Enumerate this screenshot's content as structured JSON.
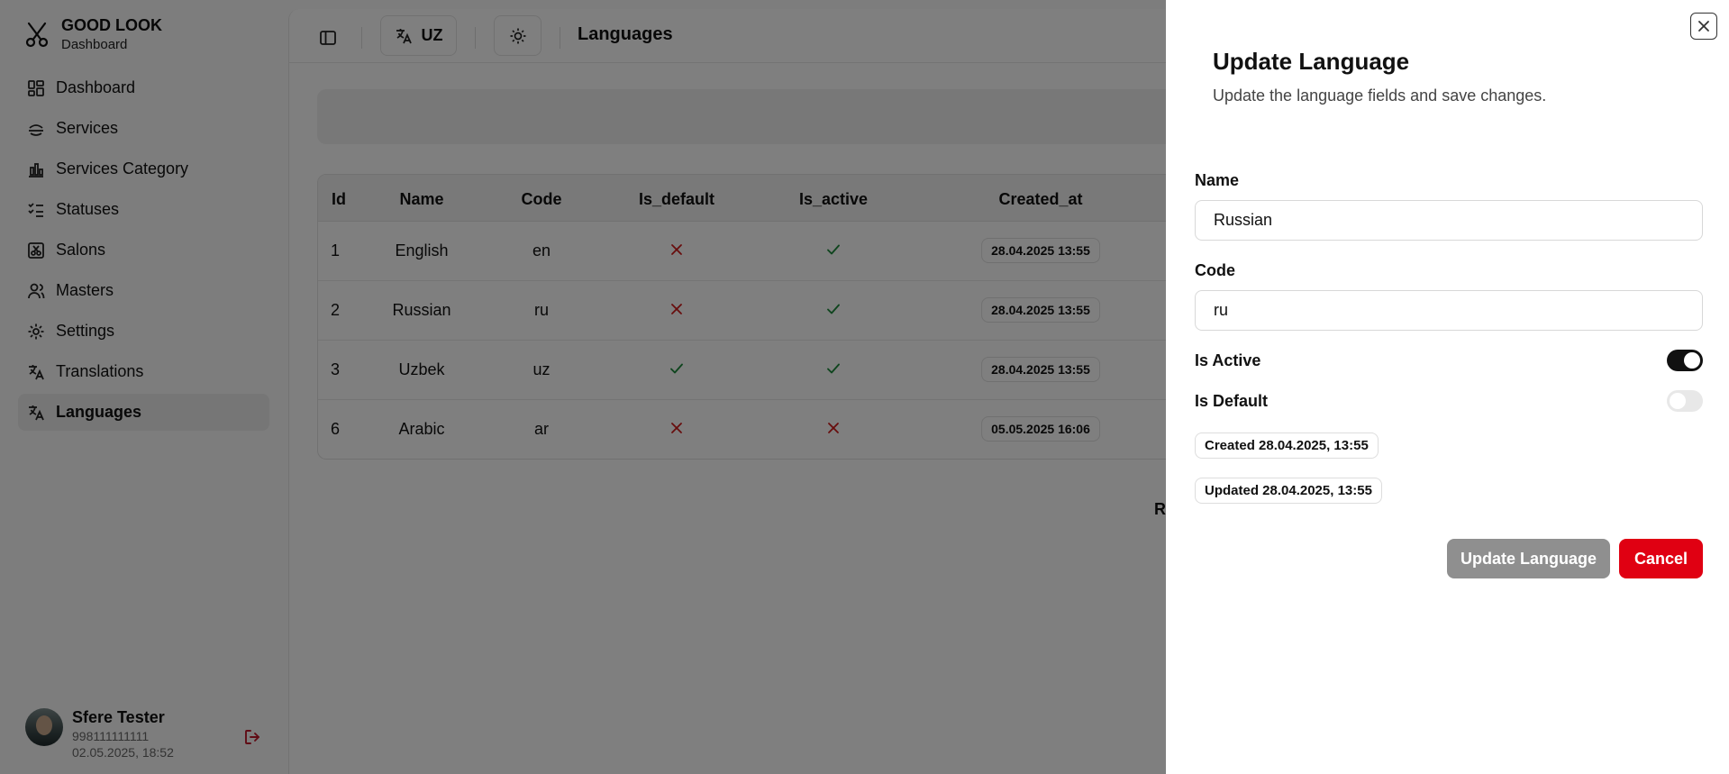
{
  "brand": {
    "title": "GOOD LOOK",
    "subtitle": "Dashboard"
  },
  "sidebar": {
    "items": [
      {
        "label": "Dashboard",
        "icon": "dashboard-icon"
      },
      {
        "label": "Services",
        "icon": "services-icon"
      },
      {
        "label": "Services Category",
        "icon": "chart-icon"
      },
      {
        "label": "Statuses",
        "icon": "list-check-icon"
      },
      {
        "label": "Salons",
        "icon": "scissors-box-icon"
      },
      {
        "label": "Masters",
        "icon": "users-icon"
      },
      {
        "label": "Settings",
        "icon": "gear-icon"
      },
      {
        "label": "Translations",
        "icon": "translate-icon"
      },
      {
        "label": "Languages",
        "icon": "translate-icon",
        "active": true
      }
    ]
  },
  "user": {
    "name": "Sfere Tester",
    "phone": "998111111111",
    "date": "02.05.2025, 18:52"
  },
  "topbar": {
    "lang_label": "UZ",
    "page_title": "Languages"
  },
  "table": {
    "columns": [
      "Id",
      "Name",
      "Code",
      "Is_default",
      "Is_active",
      "Created_at"
    ],
    "rows": [
      {
        "id": "1",
        "name": "English",
        "code": "en",
        "is_default": false,
        "is_active": true,
        "created_at": "28.04.2025 13:55"
      },
      {
        "id": "2",
        "name": "Russian",
        "code": "ru",
        "is_default": false,
        "is_active": true,
        "created_at": "28.04.2025 13:55"
      },
      {
        "id": "3",
        "name": "Uzbek",
        "code": "uz",
        "is_default": true,
        "is_active": true,
        "created_at": "28.04.2025 13:55"
      },
      {
        "id": "6",
        "name": "Arabic",
        "code": "ar",
        "is_default": false,
        "is_active": false,
        "created_at": "05.05.2025 16:06"
      }
    ],
    "footer_partial": "Ro"
  },
  "sheet": {
    "title": "Update Language",
    "description": "Update the language fields and save changes.",
    "name_label": "Name",
    "name_value": "Russian",
    "code_label": "Code",
    "code_value": "ru",
    "is_active_label": "Is Active",
    "is_active": true,
    "is_default_label": "Is Default",
    "is_default": false,
    "created": "Created 28.04.2025, 13:55",
    "updated": "Updated 28.04.2025, 13:55",
    "update_button": "Update Language",
    "cancel_button": "Cancel"
  },
  "colors": {
    "check": "#1e8a3c",
    "cross": "#d11a1a",
    "cancel": "#e00012",
    "update_disabled": "#8f8f8f"
  }
}
